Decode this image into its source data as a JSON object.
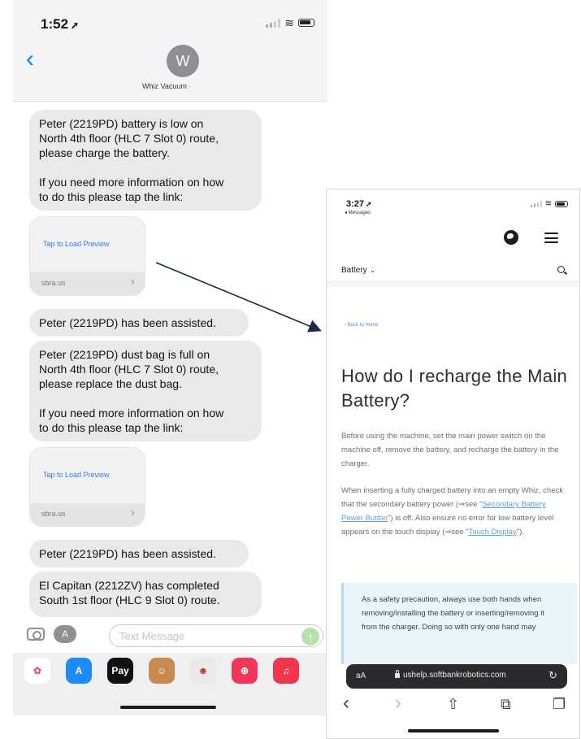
{
  "messages_screen": {
    "status": {
      "time": "1:52",
      "location_glyph": "➚"
    },
    "header": {
      "back_glyph": "‹",
      "avatar_initial": "W",
      "contact_name": "Whiz Vacuum",
      "contact_chevron": "›"
    },
    "thread": {
      "msg1": {
        "p1": "Peter (2219PD) battery is low on\nNorth 4th floor (HLC 7 Slot 0) route,\nplease charge the battery.",
        "p2": "If you need more information on how\nto do this please tap the link:"
      },
      "link1": {
        "label": "Tap to Load Preview",
        "domain": "sbra.us",
        "arrow": "›"
      },
      "msg2": "Peter (2219PD) has been assisted.",
      "msg3": {
        "p1": "Peter (2219PD) dust bag is full on\nNorth 4th floor (HLC 7 Slot 0) route,\nplease replace the dust bag.",
        "p2": "If you need more information on how\nto do this please tap the link:"
      },
      "link2": {
        "label": "Tap to Load Preview",
        "domain": "sbra.us",
        "arrow": "›"
      },
      "msg4": "Peter (2219PD) has been assisted.",
      "msg5": "El Capitan (2212ZV) has completed\nSouth 1st floor (HLC 9 Slot 0) route."
    },
    "composer": {
      "placeholder": "Text Message",
      "apps_glyph": "A",
      "send_glyph": "↑"
    },
    "app_tray": [
      {
        "name": "photos-app-icon",
        "glyph": "✿",
        "color": "#ffffff",
        "fg": "#e94f8a"
      },
      {
        "name": "app-store-icon",
        "glyph": "A",
        "color": "#1d8cf8",
        "fg": "#ffffff"
      },
      {
        "name": "apple-pay-icon",
        "glyph": "Pay",
        "color": "#111111",
        "fg": "#ffffff"
      },
      {
        "name": "memoji-icon",
        "glyph": "☺",
        "color": "#c88a4e",
        "fg": "#ffffff"
      },
      {
        "name": "animoji-icon",
        "glyph": "☻",
        "color": "#e9e9eb",
        "fg": "#c0392b"
      },
      {
        "name": "image-search-icon",
        "glyph": "⊕",
        "color": "#f2365a",
        "fg": "#ffffff"
      },
      {
        "name": "music-icon",
        "glyph": "♫",
        "color": "#f0364c",
        "fg": "#ffffff"
      }
    ]
  },
  "safari_screen": {
    "status": {
      "time": "3:27",
      "location_glyph": "➚",
      "back_app": "◂ Messages"
    },
    "nav": {
      "category": "Battery",
      "category_chevron": "⌄"
    },
    "back_link": "‹ Back to Home",
    "title": "How do I recharge the Main Battery?",
    "para1": "Before using the machine, set the main power switch on the machine off, remove the battery, and recharge the battery in the charger.",
    "para2": {
      "t1": "When inserting a fully charged battery into an empty Whiz, check that the secondary battery power (⇒see \"",
      "link1": "Secondary Battery Power Button",
      "t2": "\") is off. Also ensure no error for low battery level appears on the touch display (⇒see \"",
      "link2": "Touch Display",
      "t3": "\")."
    },
    "callout": "As a safety precaution, always use both hands when removing/installing the battery or inserting/removing it from the charger. Doing so with only one hand may",
    "url_bar": {
      "aa": "aA",
      "url": "ushelp.softbankrobotics.com",
      "reload_glyph": "↻"
    },
    "toolbar": {
      "back": "‹",
      "forward": "›",
      "share": "⇧",
      "bookmarks": "⧉",
      "tabs": "❐"
    }
  },
  "colors": {
    "ios_blue": "#1a7cf5",
    "bubble_gray": "#e9e9eb",
    "link_blue": "#5ba0e0",
    "callout_bg": "#eaf4fb"
  }
}
